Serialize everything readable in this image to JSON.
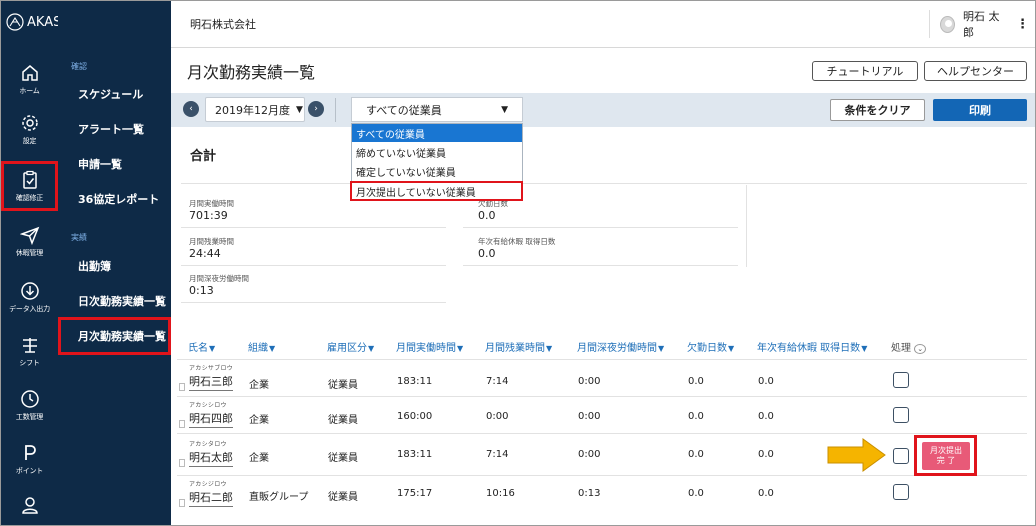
{
  "brand": {
    "logo_text": "AKASHI"
  },
  "rail": [
    {
      "label": "ホーム",
      "icon": "home-icon"
    },
    {
      "label": "設定",
      "icon": "gear-icon"
    },
    {
      "label": "確認修正",
      "icon": "clipboard-check-icon"
    },
    {
      "label": "休暇管理",
      "icon": "plane-icon"
    },
    {
      "label": "データ入出力",
      "icon": "download-icon"
    },
    {
      "label": "シフト",
      "icon": "shift-icon"
    },
    {
      "label": "工数管理",
      "icon": "clock-icon"
    },
    {
      "label": "ポイント",
      "icon": "point-icon"
    },
    {
      "label": "",
      "icon": "user-icon"
    }
  ],
  "submenu": {
    "cat1": "確認",
    "items1": [
      "スケジュール",
      "アラート一覧",
      "申請一覧",
      "36協定レポート"
    ],
    "cat2": "実績",
    "items2": [
      "出勤簿",
      "日次勤務実績一覧",
      "月次勤務実績一覧"
    ]
  },
  "header": {
    "company": "明石株式会社",
    "user": "明石 太郎",
    "menu": "⋮"
  },
  "page": {
    "title": "月次勤務実績一覧",
    "tutorial": "チュートリアル",
    "help": "ヘルプセンター"
  },
  "toolbar": {
    "prev": "‹",
    "month": "2019年12月度",
    "next": "›",
    "employee_filter": "すべての従業員",
    "clear": "条件をクリア",
    "print": "印刷"
  },
  "dropdown": {
    "options": [
      "すべての従業員",
      "締めていない従業員",
      "確定していない従業員",
      "月次提出していない従業員"
    ]
  },
  "summary": {
    "title": "合計",
    "stats": [
      {
        "label": "月間実働時間",
        "value": "701:39"
      },
      {
        "label": "月間残業時間",
        "value": "24:44"
      },
      {
        "label": "月間深夜労働時間",
        "value": "0:13"
      },
      {
        "label": "欠勤日数",
        "value": "0.0"
      },
      {
        "label": "年次有給休暇 取得日数",
        "value": "0.0"
      }
    ]
  },
  "table": {
    "headers": [
      "氏名",
      "組織",
      "雇用区分",
      "月間実働時間",
      "月間残業時間",
      "月間深夜労働時間",
      "欠勤日数",
      "年次有給休暇 取得日数",
      "処理"
    ],
    "arrow": "▼",
    "info": "⌄",
    "rows": [
      {
        "kana": "アカシサブロウ",
        "name": "明石三郎",
        "org": "企業",
        "type": "従業員",
        "work": "183:11",
        "over": "7:14",
        "night": "0:00",
        "absent": "0.0",
        "paid": "0.0"
      },
      {
        "kana": "アカシシロウ",
        "name": "明石四郎",
        "org": "企業",
        "type": "従業員",
        "work": "160:00",
        "over": "0:00",
        "night": "0:00",
        "absent": "0.0",
        "paid": "0.0"
      },
      {
        "kana": "アカシタロウ",
        "name": "明石太郎",
        "org": "企業",
        "type": "従業員",
        "work": "183:11",
        "over": "7:14",
        "night": "0:00",
        "absent": "0.0",
        "paid": "0.0"
      },
      {
        "kana": "アカシジロウ",
        "name": "明石二郎",
        "org": "直販グループ",
        "type": "従業員",
        "work": "175:17",
        "over": "10:16",
        "night": "0:13",
        "absent": "0.0",
        "paid": "0.0"
      }
    ],
    "badge": {
      "line1": "月次提出",
      "line2": "完 了"
    }
  },
  "colors": {
    "sidebar": "#0e2a47",
    "accent": "#1366b5",
    "highlight": "#e0141b",
    "badge": "#e85a78",
    "arrow": "#f5b400"
  }
}
